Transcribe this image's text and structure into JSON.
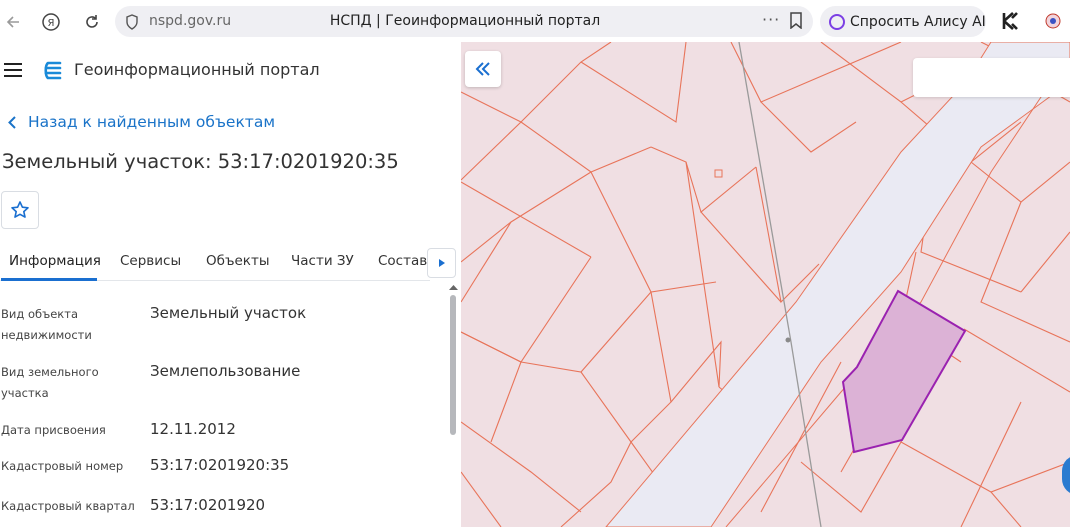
{
  "browser": {
    "url": "nspd.gov.ru",
    "tab_title": "НСПД | Геоинформационный портал",
    "alice_label": "Спросить Алису AI"
  },
  "header": {
    "portal_name": "Геоинформационный портал"
  },
  "nav": {
    "back_label": "Назад к найденным объектам"
  },
  "object": {
    "title": "Земельный участок: 53:17:0201920:35"
  },
  "tabs": [
    {
      "label": "Информация",
      "active": true
    },
    {
      "label": "Сервисы",
      "active": false
    },
    {
      "label": "Объекты",
      "active": false
    },
    {
      "label": "Части ЗУ",
      "active": false
    },
    {
      "label": "Состав",
      "active": false
    }
  ],
  "properties": [
    {
      "label": "Вид объекта недвижимости",
      "value": "Земельный участок"
    },
    {
      "label": "Вид земельного участка",
      "value": "Землепользование"
    },
    {
      "label": "Дата присвоения",
      "value": "12.11.2012"
    },
    {
      "label": "Кадастровый номер",
      "value": "53:17:0201920:35"
    },
    {
      "label": "Кадастровый квартал",
      "value": "53:17:0201920"
    }
  ],
  "colors": {
    "accent": "#1a73c8",
    "map_background": "#f0dfe3",
    "parcel_lines": "#e8745a",
    "road": "#eaeaf3",
    "selected_parcel_fill": "#dcb2d6",
    "selected_parcel_stroke": "#9a22b0"
  }
}
